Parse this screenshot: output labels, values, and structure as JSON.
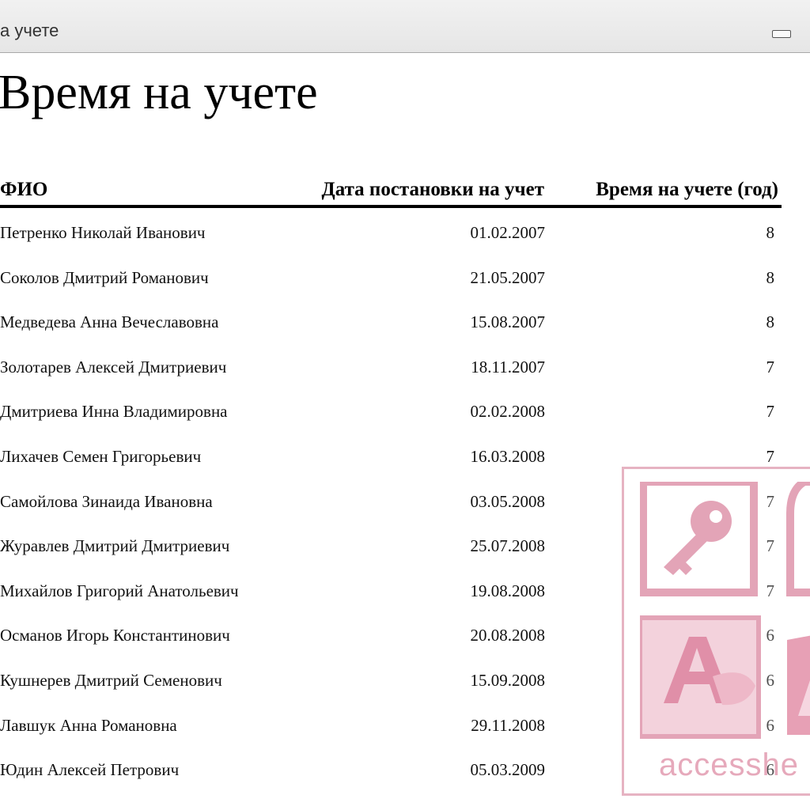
{
  "window": {
    "tab_title": "а учете"
  },
  "report": {
    "title": "Время на учете",
    "columns": {
      "name": "ФИО",
      "date": "Дата постановки на учет",
      "years": "Время на учете (год)"
    },
    "rows": [
      {
        "name": "Петренко Николай Иванович",
        "date": "01.02.2007",
        "years": "8"
      },
      {
        "name": "Соколов Дмитрий Романович",
        "date": "21.05.2007",
        "years": "8"
      },
      {
        "name": "Медведева Анна Вечеславовна",
        "date": "15.08.2007",
        "years": "8"
      },
      {
        "name": "Золотарев Алексей Дмитриевич",
        "date": "18.11.2007",
        "years": "7"
      },
      {
        "name": "Дмитриева Инна Владимировна",
        "date": "02.02.2008",
        "years": "7"
      },
      {
        "name": "Лихачев Семен Григорьевич",
        "date": "16.03.2008",
        "years": "7"
      },
      {
        "name": "Самойлова Зинаида Ивановна",
        "date": "03.05.2008",
        "years": "7"
      },
      {
        "name": "Журавлев Дмитрий Дмитриевич",
        "date": "25.07.2008",
        "years": "7"
      },
      {
        "name": "Михайлов Григорий Анатольевич",
        "date": "19.08.2008",
        "years": "7"
      },
      {
        "name": "Османов Игорь Константинович",
        "date": "20.08.2008",
        "years": "6"
      },
      {
        "name": "Кушнерев Дмитрий Семенович",
        "date": "15.09.2008",
        "years": "6"
      },
      {
        "name": "Лавшук Анна Романовна",
        "date": "29.11.2008",
        "years": "6"
      },
      {
        "name": "Юдин Алексей Петрович",
        "date": "05.03.2009",
        "years": "6"
      }
    ]
  },
  "watermark": {
    "text": "accesshe",
    "color": "#e6a9bb"
  },
  "icons": {
    "minimize": "minimize-icon",
    "logo": "access-key-logo-icon"
  }
}
